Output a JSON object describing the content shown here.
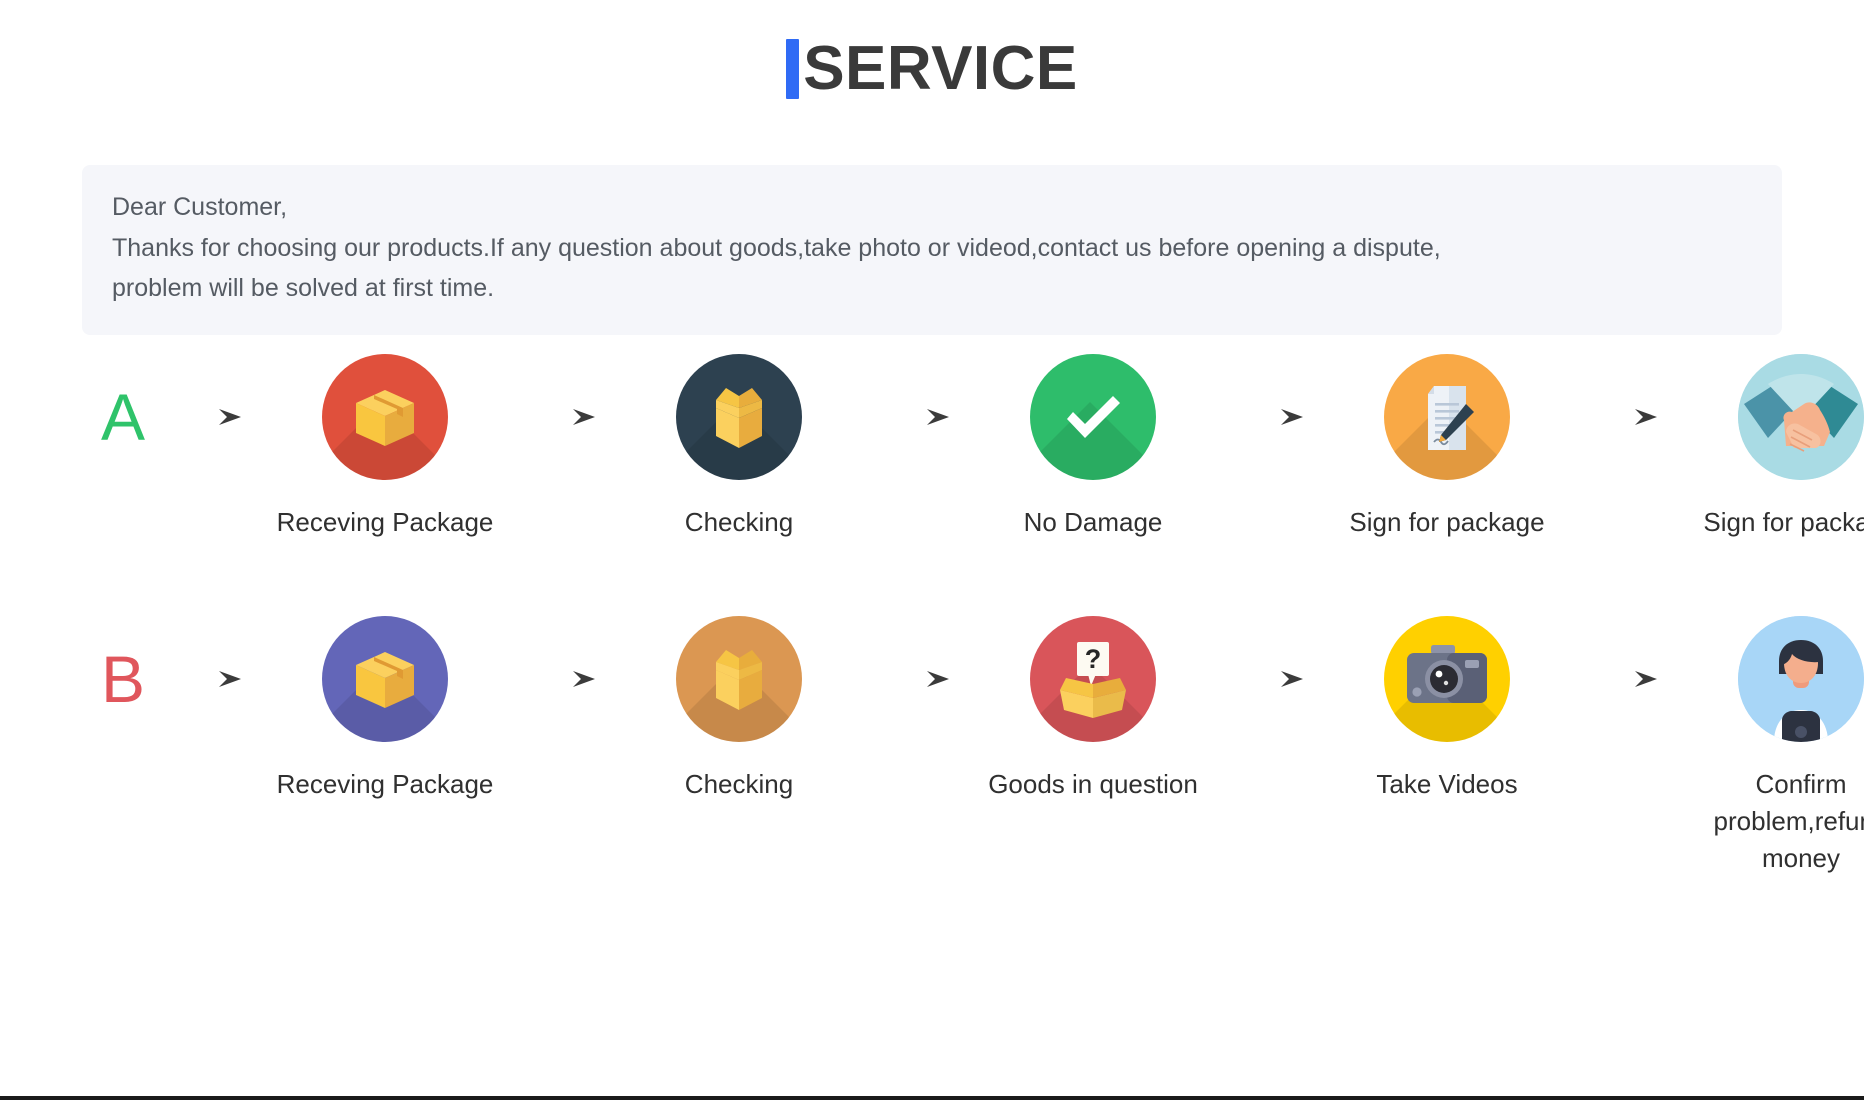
{
  "page": {
    "title_accent_color": "#2f6bf5",
    "title": "SERVICE"
  },
  "notice": {
    "line1": "Dear Customer,",
    "line2": "Thanks for choosing our products.If any question about goods,take photo or videod,contact us before opening a dispute,",
    "line3": "problem will be solved at first time."
  },
  "flows": {
    "row_a": {
      "letter": "A",
      "letter_color": "#2fc36a",
      "steps": [
        {
          "label": "Receving Package",
          "icon": "closed-box-icon",
          "circle_color": "#e0503c"
        },
        {
          "label": "Checking",
          "icon": "open-box-icon",
          "circle_color": "#2d4150"
        },
        {
          "label": "No Damage",
          "icon": "check-icon",
          "circle_color": "#2ebd6b"
        },
        {
          "label": "Sign for package",
          "icon": "document-pen-icon",
          "circle_color": "#f9a946"
        },
        {
          "label": "Sign for package",
          "icon": "handshake-icon",
          "circle_color": "#a9dbe4"
        }
      ],
      "repeat_letter": "A",
      "repeat_icon": "closed-box-icon",
      "repeat_circle_color": "#e0503c"
    },
    "row_b": {
      "letter": "B",
      "letter_color": "#e0565c",
      "steps": [
        {
          "label": "Receving Package",
          "icon": "closed-box-icon",
          "circle_color": "#6366b8"
        },
        {
          "label": "Checking",
          "icon": "open-box-icon",
          "circle_color": "#db9752"
        },
        {
          "label": "Goods in question",
          "icon": "question-box-icon",
          "circle_color": "#d9555a"
        },
        {
          "label": "Take Videos",
          "icon": "camera-icon",
          "circle_color": "#ffd000"
        },
        {
          "label": "Confirm problem,refund money",
          "icon": "support-agent-icon",
          "circle_color": "#a8d6f7"
        }
      ]
    },
    "arrow_icon": "arrow-right-icon"
  }
}
